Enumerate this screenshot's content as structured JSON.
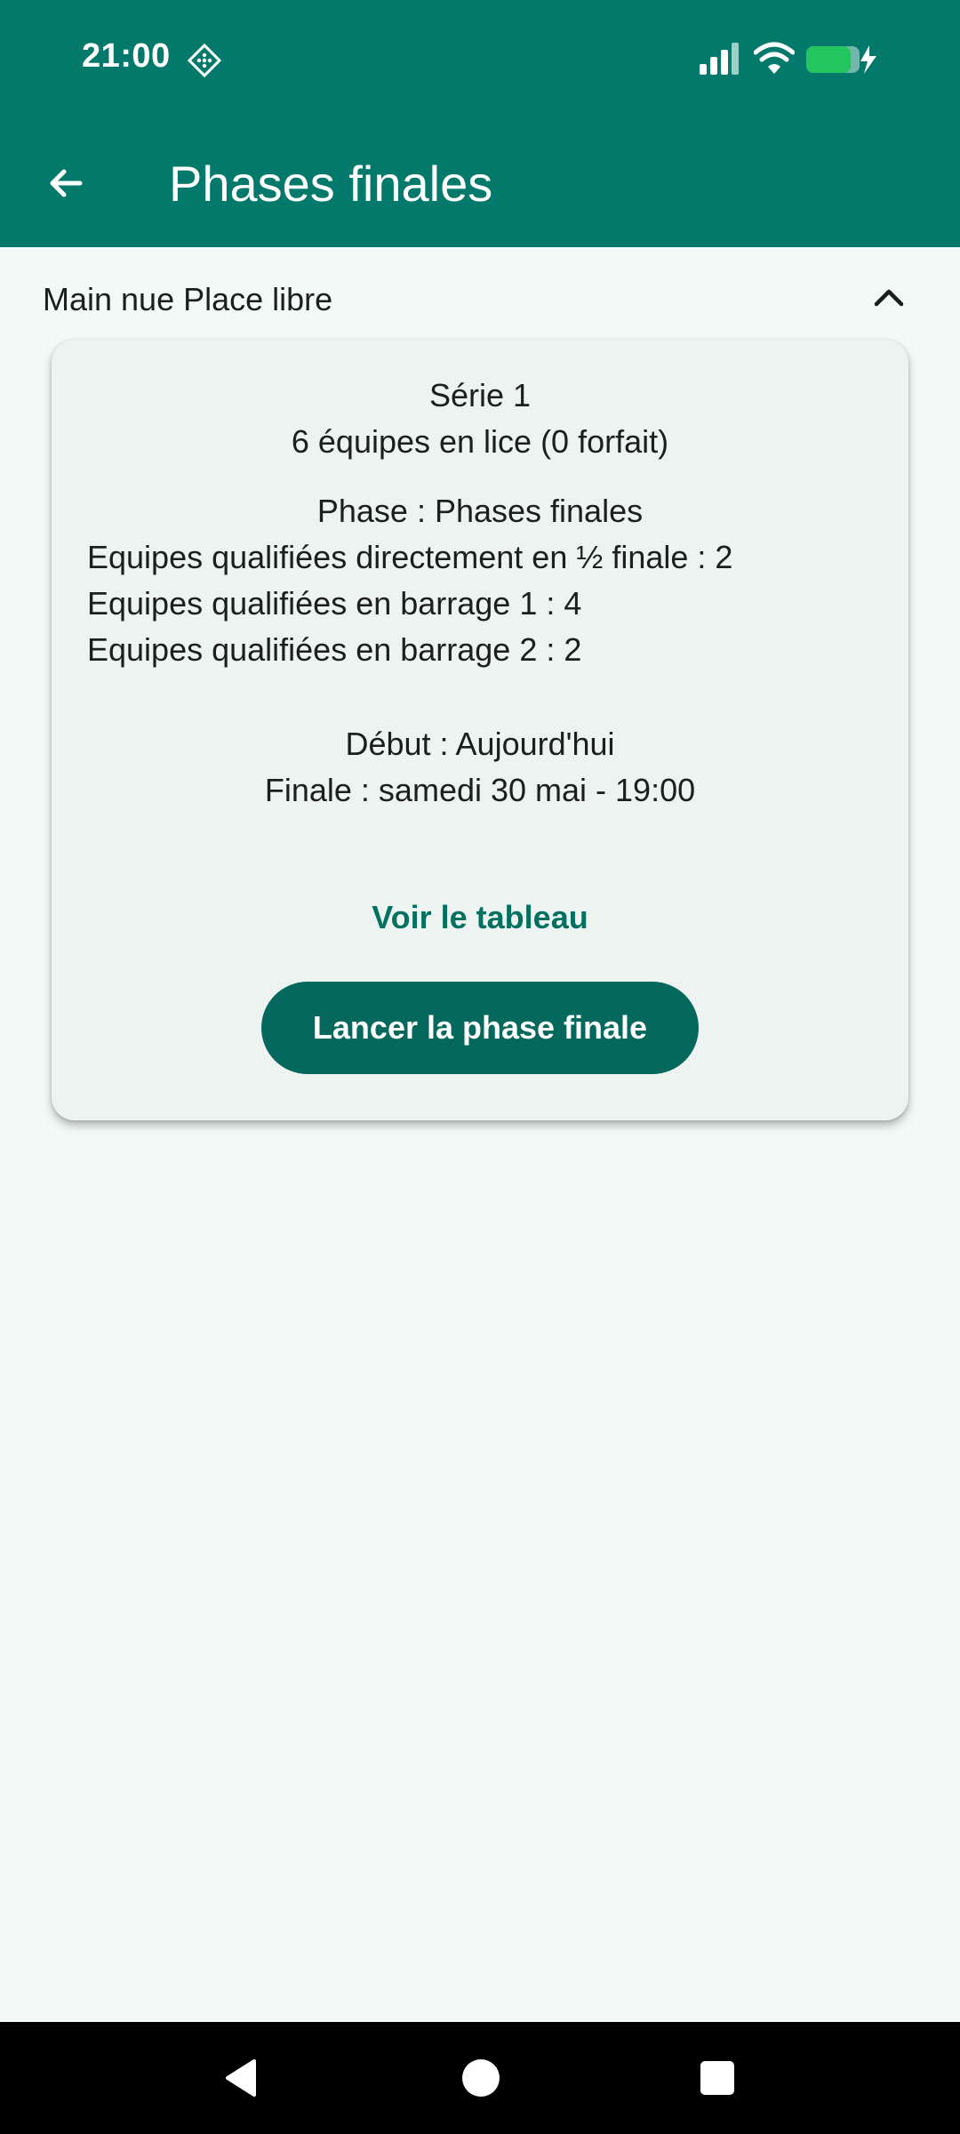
{
  "status_bar": {
    "time": "21:00",
    "icons": [
      "diamond-grid-icon",
      "cellular-signal-icon",
      "wifi-icon",
      "battery-charging-icon"
    ]
  },
  "app_bar": {
    "title": "Phases finales",
    "back_icon": "arrow-left-icon"
  },
  "section": {
    "title": "Main nue Place libre",
    "toggle_icon": "chevron-up-icon"
  },
  "card": {
    "series": "Série 1",
    "teams": "6 équipes en lice (0 forfait)",
    "phase": "Phase : Phases finales",
    "qualified_semi": "Equipes qualifiées directement en ½ finale : 2",
    "qualified_barrage1": "Equipes qualifiées en barrage 1 : 4",
    "qualified_barrage2": "Equipes qualifiées en barrage 2 : 2",
    "start": "Début : Aujourd'hui",
    "final": "Finale : samedi 30 mai - 19:00",
    "view_link": "Voir le tableau",
    "launch_button": "Lancer la phase finale"
  },
  "nav_bar": {
    "icons": [
      "back-triangle-icon",
      "home-circle-icon",
      "recents-square-icon"
    ]
  },
  "colors": {
    "primary": "#02796A",
    "button": "#05685C",
    "link": "#04705F",
    "background": "#F3F9F7",
    "card": "#EDF3F1",
    "battery": "#22C55E"
  }
}
